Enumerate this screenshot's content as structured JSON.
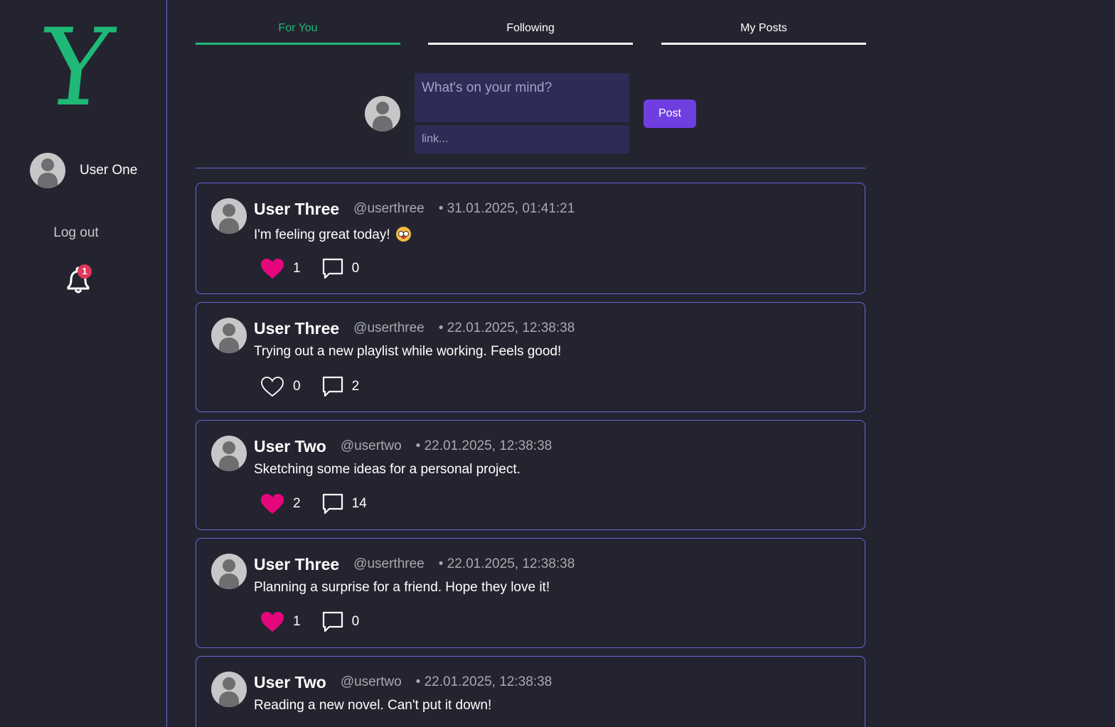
{
  "sidebar": {
    "logo_text": "Y",
    "user_name": "User One",
    "logout_label": "Log out",
    "notification_count": "1"
  },
  "tabs": [
    {
      "label": "For You",
      "active": true
    },
    {
      "label": "Following",
      "active": false
    },
    {
      "label": "My Posts",
      "active": false
    }
  ],
  "composer": {
    "text_placeholder": "What's on your mind?",
    "link_placeholder": "link...",
    "post_label": "Post"
  },
  "colors": {
    "accent_green": "#1fb877",
    "accent_purple": "#6e3ee0",
    "border_purple": "#6b66d9",
    "like_pink": "#e6067c",
    "background": "#23242f"
  },
  "posts": [
    {
      "name": "User Three",
      "handle": "@userthree",
      "date": "• 31.01.2025, 01:41:21",
      "text": "I'm feeling great today!",
      "has_emoji": true,
      "liked": true,
      "likes": "1",
      "comments": "0"
    },
    {
      "name": "User Three",
      "handle": "@userthree",
      "date": "• 22.01.2025, 12:38:38",
      "text": "Trying out a new playlist while working. Feels good!",
      "has_emoji": false,
      "liked": false,
      "likes": "0",
      "comments": "2"
    },
    {
      "name": "User Two",
      "handle": "@usertwo",
      "date": "• 22.01.2025, 12:38:38",
      "text": "Sketching some ideas for a personal project.",
      "has_emoji": false,
      "liked": true,
      "likes": "2",
      "comments": "14"
    },
    {
      "name": "User Three",
      "handle": "@userthree",
      "date": "• 22.01.2025, 12:38:38",
      "text": "Planning a surprise for a friend. Hope they love it!",
      "has_emoji": false,
      "liked": true,
      "likes": "1",
      "comments": "0"
    },
    {
      "name": "User Two",
      "handle": "@usertwo",
      "date": "• 22.01.2025, 12:38:38",
      "text": "Reading a new novel. Can't put it down!",
      "has_emoji": false,
      "liked": null,
      "likes": null,
      "comments": null
    }
  ]
}
